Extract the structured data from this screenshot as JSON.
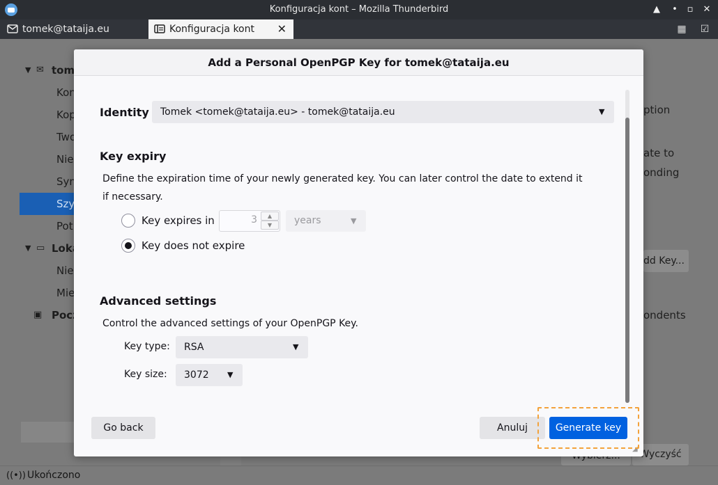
{
  "window": {
    "title": "Konfiguracja kont – Mozilla Thunderbird",
    "controls": {
      "pin": "▲",
      "minimize": "•",
      "maximize": "▫",
      "close": "✕"
    }
  },
  "tabs": [
    {
      "label": "tomek@tataija.eu",
      "icon": "mail-icon"
    },
    {
      "label": "Konfiguracja kont",
      "icon": "settings-tab-icon",
      "close": "✕"
    }
  ],
  "toolbar_icons": [
    "calendar-icon",
    "tasks-icon"
  ],
  "sidebar": {
    "items": [
      {
        "label": "tom",
        "bold": true,
        "icon": "mail-icon"
      },
      {
        "label": "Kon"
      },
      {
        "label": "Kop"
      },
      {
        "label": "Two"
      },
      {
        "label": "Nie"
      },
      {
        "label": "Syn"
      },
      {
        "label": "Szy",
        "selected": true
      },
      {
        "label": "Pot"
      },
      {
        "label": "Loka",
        "bold": true,
        "icon": "folder-icon"
      },
      {
        "label": "Nie"
      },
      {
        "label": "Mie"
      },
      {
        "label": "Pocz",
        "bold": true,
        "icon": "outbox-icon"
      }
    ]
  },
  "background_right": {
    "texts": [
      "ption",
      "ate to",
      "onding",
      "ondents"
    ],
    "buttons": [
      "dd Key...",
      "Wybierz...",
      "Wyczyść"
    ]
  },
  "status": {
    "text": "Ukończono",
    "icon": "online-icon"
  },
  "dialog": {
    "title": "Add a Personal OpenPGP Key for tomek@tataija.eu",
    "identity": {
      "label": "Identity",
      "value": "Tomek <tomek@tataija.eu> - tomek@tataija.eu"
    },
    "expiry": {
      "heading": "Key expiry",
      "description": "Define the expiration time of your newly generated key. You can later control the date to extend it if necessary.",
      "option_expires": "Key expires in",
      "option_never": "Key does not expire",
      "amount": "3",
      "unit": "years",
      "selected": "never"
    },
    "advanced": {
      "heading": "Advanced settings",
      "description": "Control the advanced settings of your OpenPGP Key.",
      "key_type_label": "Key type:",
      "key_type": "RSA",
      "key_size_label": "Key size:",
      "key_size": "3072"
    },
    "buttons": {
      "back": "Go back",
      "cancel": "Anuluj",
      "generate": "Generate key"
    }
  },
  "colors": {
    "accent": "#0061e0",
    "focus": "#f3a23b",
    "selection": "#1a5fb4",
    "titlebar": "#2b2e33"
  }
}
